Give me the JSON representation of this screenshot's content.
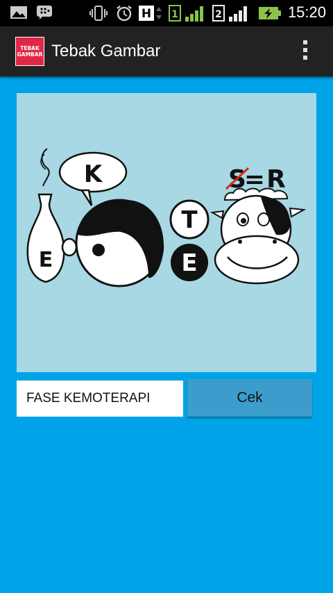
{
  "status_bar": {
    "time": "15:20",
    "sim1_label": "1",
    "sim2_label": "2",
    "network_type": "H",
    "icons": [
      "gallery-icon",
      "bbm-icon",
      "vibrate-icon",
      "alarm-icon",
      "h-network-icon",
      "sim1-signal-icon",
      "sim2-signal-icon",
      "battery-charging-icon"
    ]
  },
  "action_bar": {
    "title": "Tebak Gambar",
    "logo_line1": "TEBAK",
    "logo_line2": "GAMBAR"
  },
  "puzzle": {
    "vase_letter": "E",
    "bubble_letter": "K",
    "white_circle_letter": "T",
    "black_circle_letter": "E",
    "crossed_letter": "S",
    "equals_sign": "=",
    "replacement_letter": "R"
  },
  "answer": {
    "value": "FASE KEMOTERAPI",
    "button_label": "Cek"
  },
  "colors": {
    "background": "#00a3e8",
    "puzzle_bg": "#a7d8e3",
    "button": "#3c9dcd",
    "action_bar": "#222222",
    "logo": "#e02846"
  }
}
